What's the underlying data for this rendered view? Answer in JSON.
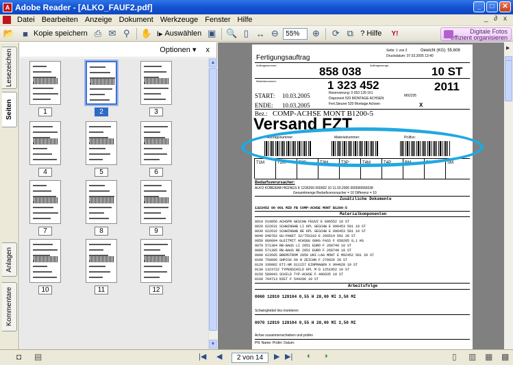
{
  "window": {
    "title": "Adobe Reader - [ALKO_FAUF2.pdf]",
    "app_icon_label": "A"
  },
  "menu": {
    "items": [
      "Datei",
      "Bearbeiten",
      "Anzeige",
      "Dokument",
      "Werkzeuge",
      "Fenster",
      "Hilfe"
    ],
    "right": "_ ∂ x"
  },
  "toolbar": {
    "save_copy": "Kopie speichern",
    "select": "Auswählen",
    "zoom": "55%",
    "help": "Hilfe",
    "promo_line1": "Digitale Fotos",
    "promo_line2": "effizient organisieren"
  },
  "sidetabs": {
    "bookmarks": "Lesezeichen",
    "pages": "Seiten",
    "attachments": "Anlagen",
    "comments": "Kommentare"
  },
  "panel": {
    "options": "Optionen",
    "close": "x"
  },
  "thumbnails": [
    "1",
    "2",
    "3",
    "4",
    "5",
    "6",
    "7",
    "8",
    "9",
    "10",
    "11",
    "12"
  ],
  "status": {
    "page_indicator": "2 von 14"
  },
  "document": {
    "title": "Fertigungsauftrag",
    "order_label": "Auftragsnummer:",
    "order_no": "858 038",
    "qty_label": "Auftragsmenge:",
    "qty": "10 ST",
    "material_label": "Materialnummer:",
    "material_no": "1 323 452",
    "year": "2011",
    "start_label": "START:",
    "start_date": "10.03.2005",
    "end_label": "ENDE:",
    "end_date": "10.03.2005",
    "bez_label": "Bez.:",
    "bez": "COMP-ACHSE MONT B1200-5",
    "disponent": "Disponent  520  MONTAGE ACHSEN",
    "fert": "Fert.Steurer  520  Montage Achsen",
    "ressort": "Reservierung:  0 053 139 161",
    "weight": "Gewicht (KG):  55,608",
    "sheet": "Seite:  1  von  2",
    "printdate": "Druckdatum: 07.03.2005  13:40",
    "x_mark": "X",
    "m_code": "M92235",
    "versand": "Versand FZT",
    "bc1_label": "Auftragsnummer:",
    "bc2_label": "Materialnummer:",
    "bc3_label": "Prüflos:",
    "routing_cells": [
      "T1M",
      "T2M",
      "T2P",
      "T3M",
      "T3P",
      "T4M",
      "T4P",
      "RM",
      "RP",
      "SM"
    ],
    "bedarf_head": "Bedarfsverursacher:",
    "bedarf_row": "ALKO KOBERAB  HIGINGS K  1236266  000002  10  11.03.2005  000000656038",
    "gesamt": "Gesamtmenge Bedarfsverursacher =  10  Differenz =  10",
    "zus_head": "Zusätzliche Dokumente",
    "doc_row": "1323452 00  001  MZD  FB  COMP-ACHSE MONT B1200-5",
    "mat_head": "Materialkomponenten",
    "material_rows": [
      "0010 619856   ACHSPR GESCHW FEUVZ         E 096552        10 ST",
      "0020 622631   SCHWINGHB LI KPL GESCHW     E 096453  501   10 ST",
      "0030 622632   SCHWINGHB RE KPL GESCHW     E 096453  501   10 ST",
      "0040 848702   GU-PAKET 32/75X310          E 266514  501   20 ST",
      "0050 800094   GLEITMIT ACHSGU 60KG FASS   F 650205       0,1 KG",
      "0070 571384   RB-BAUS LI 2051 EURO        F 268749        10 ST",
      "0080 571385   RB-BAUS RE 2051 EURO        F 268749        10 ST",
      "0090 623505   BREMSTROM 2050 UNI-LAG MONT E M92452  501   20 ST",
      "0100 750095   SHP23X 60 N ZEICHN          F 270926        20 ST",
      "0120 339982   ETI-NR 611157 EINPRAGEN     X 904028        10 ST",
      "0130 1323722  TYPENSCHILD KPL M           D 1251952       10 ST",
      "0150 589943   SCHILD TYP-ACHSE            F 496935        10 ST",
      "0160 704713   NIET                        F 544206        10 ST"
    ],
    "arb_head": "Arbeitsfolge",
    "arb_row1": "0060 12910  129104   0,55 H   28,00 MI   3,50 MI",
    "arb_text1": "Schwinghebel lins montieren",
    "arb_row2": "0070 12910  129104   0,55 H   28,00 MI   3,50 MI",
    "arb_text2": "Achse zusammenschieben und prüfen",
    "footer": "PN:  Name:  Prüfer:  Datum:"
  }
}
